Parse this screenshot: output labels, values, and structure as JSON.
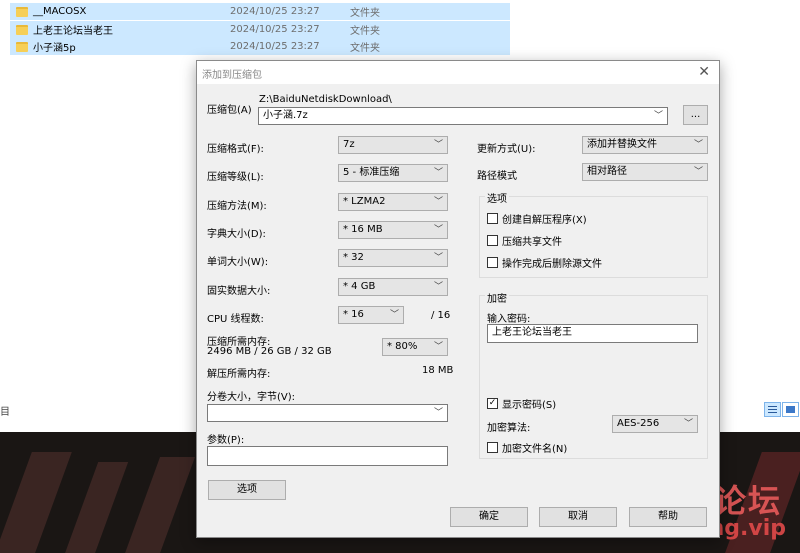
{
  "explorer": {
    "files": [
      {
        "name": "__MACOSX",
        "date": "2024/10/25 23:27",
        "type": "文件夹"
      },
      {
        "name": "上老王论坛当老王",
        "date": "2024/10/25 23:27",
        "type": "文件夹"
      },
      {
        "name": "小子涵5p",
        "date": "2024/10/25 23:27",
        "type": "文件夹"
      }
    ],
    "status_glyph": "目"
  },
  "dialog": {
    "title": "添加到压缩包",
    "close": "✕",
    "archive_label": "压缩包(A)",
    "archive_path": "Z:\\BaiduNetdiskDownload\\",
    "archive_name": "小子涵.7z",
    "browse_label": "...",
    "format_label": "压缩格式(F):",
    "format_value": "7z",
    "level_label": "压缩等级(L):",
    "level_value": "5 - 标准压缩",
    "method_label": "压缩方法(M):",
    "method_value": "* LZMA2",
    "dict_label": "字典大小(D):",
    "dict_value": "* 16 MB",
    "word_label": "单词大小(W):",
    "word_value": "* 32",
    "solid_label": "固实数据大小:",
    "solid_value": "* 4 GB",
    "cpu_label": "CPU 线程数:",
    "cpu_value": "* 16",
    "cpu_total": "/ 16",
    "mem_comp_label": "压缩所需内存:",
    "mem_comp_value": "2496 MB / 26 GB / 32 GB",
    "mem_percent": "* 80%",
    "mem_decomp_label": "解压所需内存:",
    "mem_decomp_value": "18 MB",
    "split_label": "分卷大小，字节(V):",
    "split_value": "",
    "params_label": "参数(P):",
    "params_value": "",
    "options_button": "选项",
    "update_label": "更新方式(U):",
    "update_value": "添加并替换文件",
    "path_label": "路径模式",
    "path_value": "相对路径",
    "options_group": {
      "title": "选项",
      "sfx": "创建自解压程序(X)",
      "shared": "压缩共享文件",
      "delete": "操作完成后删除源文件"
    },
    "encryption_group": {
      "title": "加密",
      "password_label": "输入密码:",
      "password_value": "上老王论坛当老王",
      "show_password": "显示密码(S)",
      "show_password_mark": "✓",
      "method_label": "加密算法:",
      "method_value": "AES-256",
      "encrypt_names": "加密文件名(N)"
    },
    "ok": "确定",
    "cancel": "取消",
    "help": "帮助"
  },
  "watermark": {
    "cn": "老王论坛",
    "url": "laowang.vip"
  }
}
